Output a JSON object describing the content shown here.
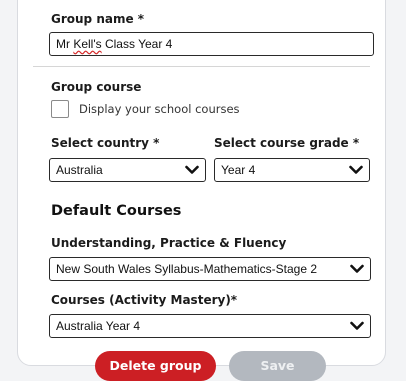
{
  "form": {
    "group_name_label": "Group name *",
    "group_name_value_prefix": "Mr ",
    "group_name_value_misspelled": "Kell's",
    "group_name_value_suffix": " Class Year 4",
    "group_course_label": "Group course",
    "display_school_courses_label": "Display your school courses",
    "display_school_courses_checked": false,
    "country_label": "Select country *",
    "country_value": "Australia",
    "grade_label": "Select course grade *",
    "grade_value": "Year 4",
    "default_courses_heading": "Default Courses",
    "upf_label": "Understanding, Practice & Fluency",
    "upf_value": "New South Wales Syllabus-Mathematics-Stage 2",
    "activity_mastery_label": "Courses (Activity Mastery)*",
    "activity_mastery_value": "Australia Year 4"
  },
  "actions": {
    "delete_label": "Delete group",
    "save_label": "Save"
  },
  "icons": {
    "select_arrow": "chevron-down-icon"
  },
  "colors": {
    "delete_button": "#cc1f24",
    "save_button_disabled": "#b3b8bf"
  }
}
